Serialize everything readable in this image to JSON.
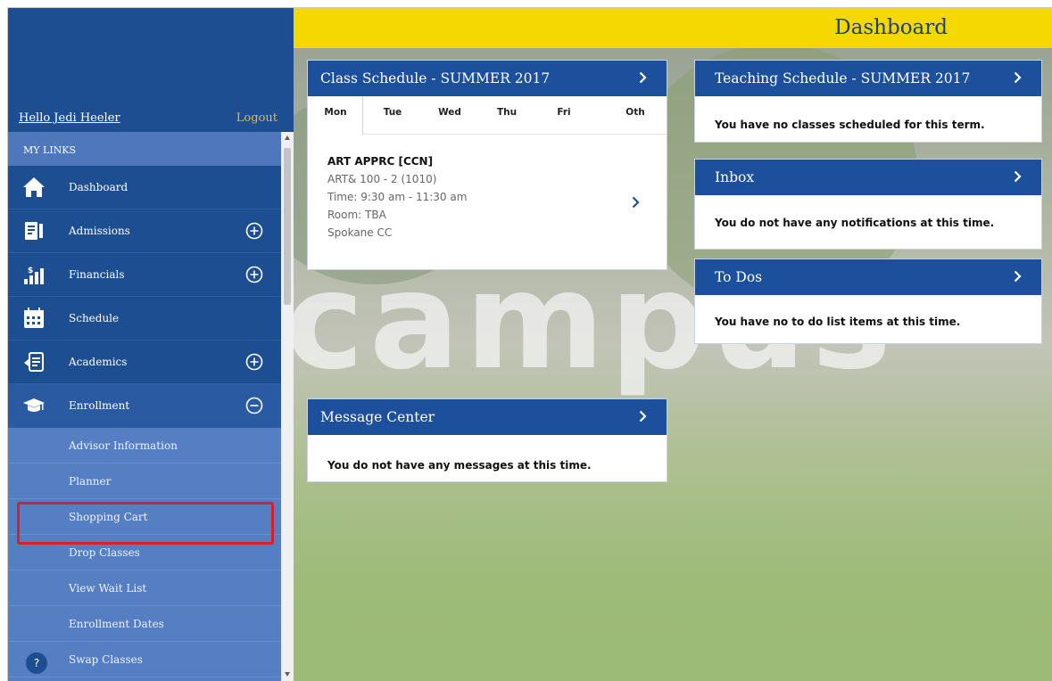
{
  "sidebar": {
    "greeting": "Hello Jedi Heeler",
    "logout": "Logout",
    "section_title": "MY LINKS",
    "items": [
      {
        "label": "Dashboard",
        "icon": "home-icon"
      },
      {
        "label": "Admissions",
        "icon": "admissions-icon",
        "toggle": "expand"
      },
      {
        "label": "Financials",
        "icon": "financials-icon",
        "toggle": "expand"
      },
      {
        "label": "Schedule",
        "icon": "calendar-icon"
      },
      {
        "label": "Academics",
        "icon": "academics-icon",
        "toggle": "expand"
      },
      {
        "label": "Enrollment",
        "icon": "graduation-cap-icon",
        "toggle": "collapse"
      }
    ],
    "enrollment_subitems": [
      "Advisor Information",
      "Planner",
      "Shopping Cart",
      "Drop Classes",
      "View Wait List",
      "Enrollment Dates",
      "Swap Classes"
    ],
    "highlighted_item": "Shopping Cart",
    "help": "?"
  },
  "header": {
    "title": "Dashboard",
    "background_color": "#f5d800"
  },
  "background": {
    "watermark_text": "campus"
  },
  "class_schedule": {
    "title": "Class Schedule - SUMMER 2017",
    "days": [
      "Mon",
      "Tue",
      "Wed",
      "Thu",
      "Fri",
      "Oth"
    ],
    "active_day": "Mon",
    "course": {
      "title": "ART APPRC [CCN]",
      "code": "ART& 100 - 2 (1010)",
      "time": "Time: 9:30 am - 11:30 am",
      "room": "Room: TBA",
      "campus": "Spokane CC"
    }
  },
  "teaching_schedule": {
    "title": "Teaching Schedule - SUMMER 2017",
    "message": "You have no classes scheduled for this term."
  },
  "inbox": {
    "title": "Inbox",
    "message": "You do not have any notifications at this time."
  },
  "todos": {
    "title": "To Dos",
    "message": "You have no to do list items at this time."
  },
  "message_center": {
    "title": "Message Center",
    "message": "You do not have any messages at this time."
  },
  "colors": {
    "sidebar_blue": "#1e4e92",
    "submenu_blue": "#567ec2",
    "card_header_blue": "#1c4f9c",
    "accent_yellow": "#f5d800",
    "highlight_red": "#d6202d"
  }
}
